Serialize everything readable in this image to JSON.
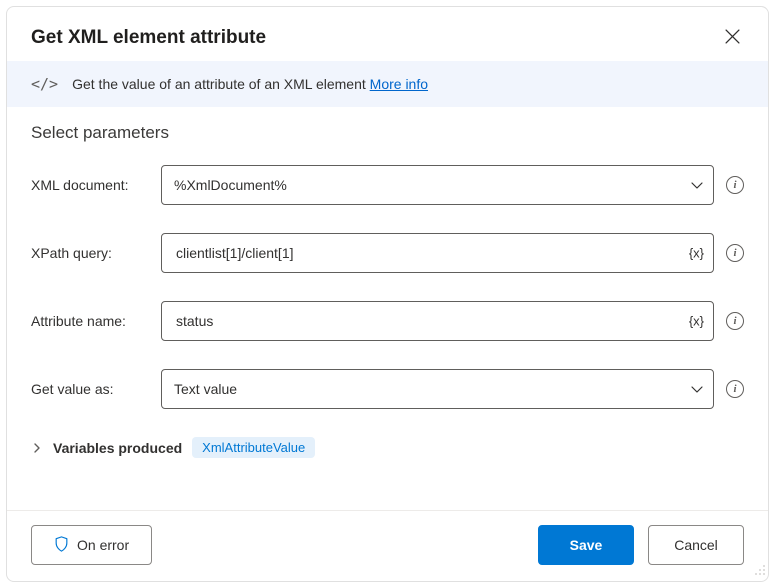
{
  "header": {
    "title": "Get XML element attribute"
  },
  "banner": {
    "description": "Get the value of an attribute of an XML element",
    "more_info": "More info"
  },
  "section": {
    "heading": "Select parameters"
  },
  "fields": {
    "xml_document": {
      "label": "XML document:",
      "value": "%XmlDocument%"
    },
    "xpath_query": {
      "label": "XPath query:",
      "value": "clientlist[1]/client[1]",
      "var_token": "{x}"
    },
    "attribute_name": {
      "label": "Attribute name:",
      "value": "status",
      "var_token": "{x}"
    },
    "get_value_as": {
      "label": "Get value as:",
      "value": "Text value"
    }
  },
  "variables": {
    "label": "Variables produced",
    "badge": "XmlAttributeValue"
  },
  "footer": {
    "on_error": "On error",
    "save": "Save",
    "cancel": "Cancel"
  }
}
